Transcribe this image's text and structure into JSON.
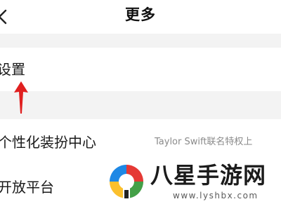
{
  "header": {
    "title": "更多",
    "back_icon": "chevron-left-icon"
  },
  "menu": {
    "settings": {
      "label": "设置"
    },
    "personalization": {
      "label": "个性化装扮中心",
      "value": "Taylor Swift联名特权上"
    },
    "open_platform": {
      "label": "开放平台"
    }
  },
  "annotation": {
    "icon": "red-up-arrow-icon",
    "color": "#e02020"
  },
  "watermark": {
    "name": "八星手游网",
    "url": "www.lyshbx.com"
  },
  "colors": {
    "background": "#ffffff",
    "separator": "#f3f3f3",
    "secondary_text": "#8a8a8a"
  }
}
